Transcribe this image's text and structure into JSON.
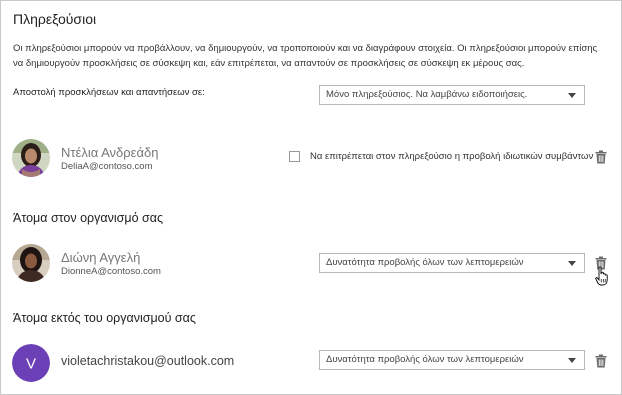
{
  "section": {
    "title": "Πληρεξούσιοι",
    "description": "Οι πληρεξούσιοι μπορούν να προβάλλουν, να δημιουργούν, να τροποποιούν και να διαγράφουν στοιχεία. Οι πληρεξούσιοι μπορούν επίσης να δημιουργούν προσκλήσεις σε σύσκεψη και, εάν επιτρέπεται, να απαντούν σε προσκλήσεις σε σύσκεψη εκ μέρους σας."
  },
  "send_invites": {
    "label": "Αποστολή προσκλήσεων και απαντήσεων σε:",
    "selected": "Μόνο πληρεξούσιος. Να λαμβάνω ειδοποιήσεις."
  },
  "delegate": {
    "name": "Ντέλια Ανδρεάδη",
    "email": "DeliaA@contoso.com",
    "private_label": "Να επιτρέπεται στον πληρεξούσιο η προβολή ιδιωτικών συμβάντων",
    "private_checked": false
  },
  "inside_org": {
    "title": "Άτομα στον οργανισμό σας",
    "person": {
      "name": "Διώνη Αγγελή",
      "email": "DionneA@contoso.com",
      "permission": "Δυνατότητα προβολής όλων των λεπτομερειών"
    }
  },
  "outside_org": {
    "title": "Άτομα εκτός του οργανισμού σας",
    "person": {
      "initial": "V",
      "email": "violetachristakou@outlook.com",
      "permission": "Δυνατότητα προβολής όλων των λεπτομερειών",
      "avatar_color": "#6b3fb5"
    }
  },
  "icons": {
    "trash": "trash-icon",
    "cursor": "hand-pointer-icon"
  }
}
